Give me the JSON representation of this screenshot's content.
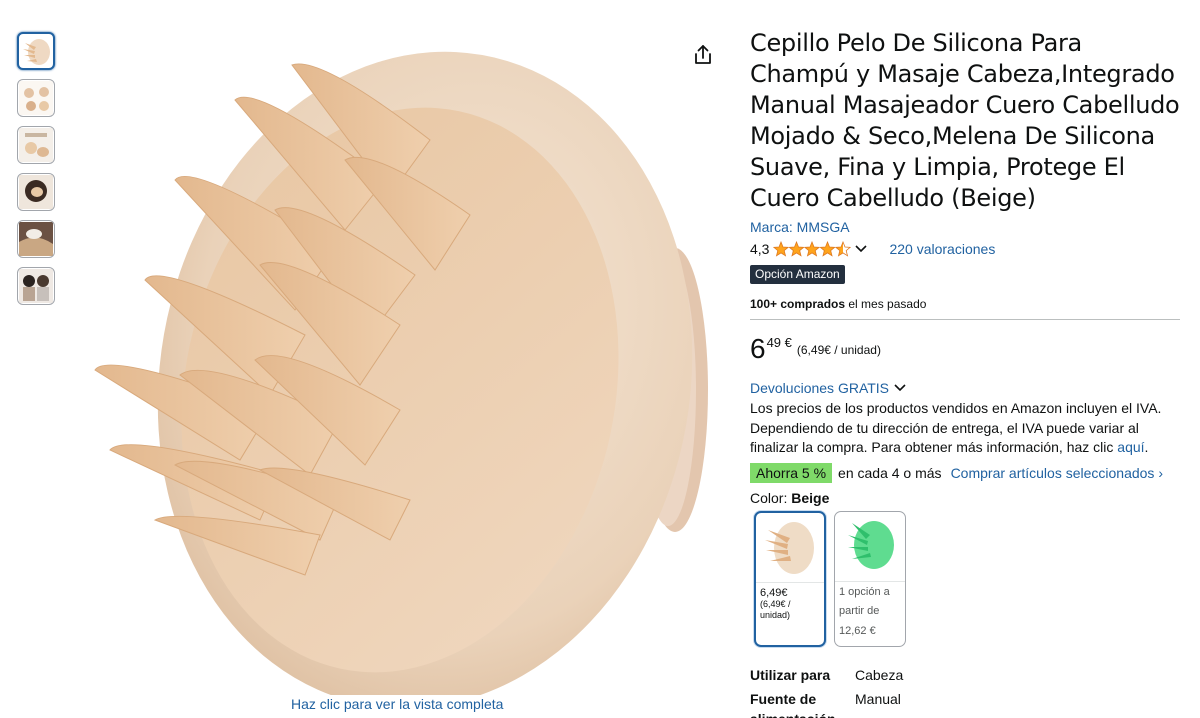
{
  "thumbnails": [
    {
      "name": "thumbnail-brush",
      "selected": true
    },
    {
      "name": "thumbnail-hands",
      "selected": false
    },
    {
      "name": "thumbnail-features",
      "selected": false
    },
    {
      "name": "thumbnail-hair-use",
      "selected": false
    },
    {
      "name": "thumbnail-hair-lather",
      "selected": false
    },
    {
      "name": "thumbnail-people",
      "selected": false
    }
  ],
  "gallery": {
    "zoom_link": "Haz clic para ver la vista completa",
    "share_icon": "share-icon"
  },
  "product": {
    "title": "Cepillo Pelo De Silicona Para Champú y Masaje Cabeza,Integrado Manual Masajeador Cuero Cabelludo Mojado & Seco,Melena De Silicona Suave, Fina y Limpia, Protege El Cuero Cabelludo (Beige)",
    "brand": "Marca: MMSGA",
    "rating": "4,3",
    "rating_stars": 4.3,
    "reviews": "220 valoraciones",
    "badge": "Opción Amazon",
    "bought_bold": "100+ comprados",
    "bought_rest": " el mes pasado"
  },
  "price": {
    "whole": "6",
    "fraction": "49 €",
    "unit": "(6,49€ / unidad)"
  },
  "returns": "Devoluciones GRATIS",
  "vat": {
    "text": "Los precios de los productos vendidos en Amazon incluyen el IVA. Dependiendo de tu dirección de entrega, el IVA puede variar al finalizar la compra. Para obtener más información, haz clic ",
    "link": "aquí",
    "end": "."
  },
  "savings": {
    "badge": "Ahorra 5 %",
    "text": "en cada 4 o más",
    "link": "Comprar artículos seleccionados ›"
  },
  "color": {
    "label": "Color: ",
    "selected": "Beige",
    "options": [
      {
        "price": "6,49€",
        "unit": "(6,49€ / unidad)",
        "accent": "#e8c9a6"
      },
      {
        "text": "1 opción a partir de 12,62 €",
        "accent": "#3ccf7a"
      }
    ]
  },
  "specs": [
    {
      "key": "Utilizar para",
      "value": "Cabeza"
    },
    {
      "key": "Fuente de alimentación",
      "value": "Manual"
    }
  ],
  "colors": {
    "link": "#2162a1",
    "star": "#ffa41c",
    "save_badge": "#7fda69",
    "badge_bg": "#232f3e"
  }
}
